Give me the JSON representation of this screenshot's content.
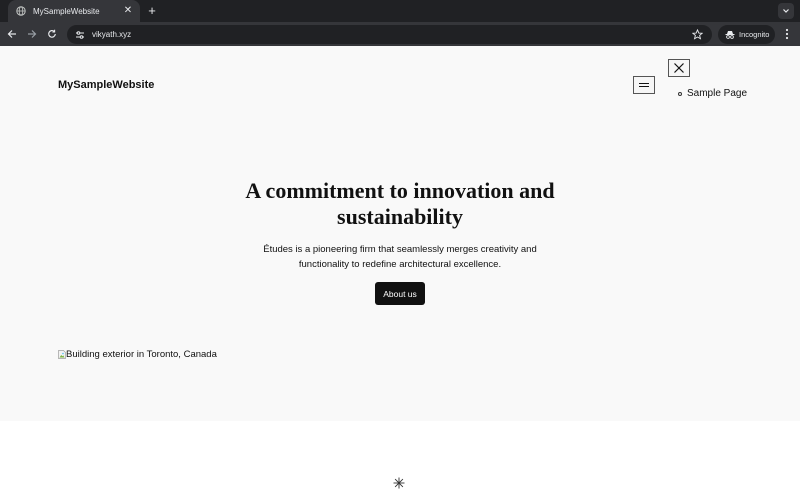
{
  "browser": {
    "tab": {
      "title": "MySampleWebsite",
      "favicon": "globe-icon",
      "close_icon": "close-icon"
    },
    "new_tab_label": "+",
    "url": "vikyath.xyz",
    "incognito_label": "Incognito",
    "colors": {
      "tabstrip_bg": "#202124",
      "toolbar_bg": "#35363a",
      "text": "#e8eaed"
    }
  },
  "site": {
    "title": "MySampleWebsite",
    "menu_toggle_icon": "hamburger-icon",
    "menu_close_icon": "close-icon",
    "menu_items": [
      {
        "label": "Sample Page"
      }
    ]
  },
  "hero": {
    "headline": "A commitment to innovation and sustainability",
    "subtext": "Études is a pioneering firm that seamlessly merges creativity and functionality to redefine architectural excellence.",
    "button_label": "About us",
    "background": "#f9f9f9"
  },
  "image": {
    "alt": "Building exterior in Toronto, Canada",
    "icon": "broken-image-icon"
  },
  "footer": {
    "decoration_icon": "asterisk-icon"
  }
}
